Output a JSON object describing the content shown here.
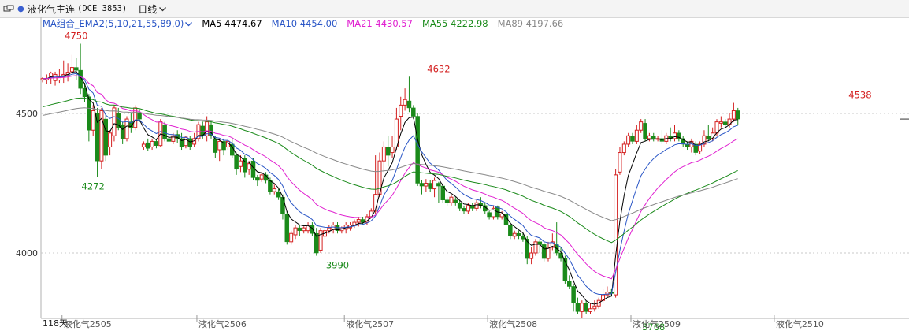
{
  "toolbar": {
    "window_icon": "window-restore-icon",
    "contract_name": "液化气主连",
    "contract_code": "(DCE 3853)",
    "period": "日线",
    "period_icon": "chevron-down-icon"
  },
  "legend": {
    "ma_group": "MA组合_EMA2(5,10,21,55,89,0)",
    "ma_group_icon": "chevron-down-icon",
    "items": [
      {
        "label": "MA5 4474.67",
        "color": "#000000"
      },
      {
        "label": "MA10 4454.00",
        "color": "#2a56c6"
      },
      {
        "label": "MA21 4430.57",
        "color": "#e020d0"
      },
      {
        "label": "MA55 4222.98",
        "color": "#1a8a1a"
      },
      {
        "label": "MA89 4197.66",
        "color": "#888888"
      }
    ]
  },
  "chart_data": {
    "type": "candlestick",
    "y_ticks": [
      4000,
      4500
    ],
    "x_labels": [
      {
        "label": "液化气2505",
        "index": 5
      },
      {
        "label": "液化气2506",
        "index": 37
      },
      {
        "label": "液化气2507",
        "index": 72
      },
      {
        "label": "液化气2508",
        "index": 106
      },
      {
        "label": "液化气2509",
        "index": 140
      },
      {
        "label": "液化气2510",
        "index": 174
      }
    ],
    "bottom_note": "118天",
    "annotations": [
      {
        "text": "4750",
        "index": 8,
        "value": 4750,
        "kind": "high"
      },
      {
        "text": "4272",
        "index": 12,
        "value": 4272,
        "kind": "low"
      },
      {
        "text": "3990",
        "index": 70,
        "value": 3990,
        "kind": "low"
      },
      {
        "text": "4632",
        "index": 94,
        "value": 4632,
        "kind": "high"
      },
      {
        "text": "3768",
        "index": 145,
        "value": 3768,
        "kind": "low"
      },
      {
        "text": "4538",
        "index": 194,
        "value": 4538,
        "kind": "high"
      }
    ],
    "up_color": "#d42020",
    "down_color": "#1a8a1a",
    "candles": [
      [
        4620,
        4625,
        4612,
        4630
      ],
      [
        4620,
        4625,
        4605,
        4640
      ],
      [
        4630,
        4645,
        4605,
        4650
      ],
      [
        4618,
        4640,
        4600,
        4650
      ],
      [
        4620,
        4630,
        4610,
        4660
      ],
      [
        4630,
        4640,
        4610,
        4690
      ],
      [
        4640,
        4648,
        4615,
        4680
      ],
      [
        4650,
        4665,
        4630,
        4710
      ],
      [
        4665,
        4655,
        4620,
        4700
      ],
      [
        4655,
        4590,
        4570,
        4750
      ],
      [
        4590,
        4560,
        4540,
        4610
      ],
      [
        4560,
        4440,
        4400,
        4570
      ],
      [
        4440,
        4510,
        4420,
        4530
      ],
      [
        4500,
        4330,
        4272,
        4520
      ],
      [
        4330,
        4510,
        4300,
        4520
      ],
      [
        4480,
        4350,
        4330,
        4500
      ],
      [
        4380,
        4430,
        4350,
        4440
      ],
      [
        4420,
        4520,
        4400,
        4530
      ],
      [
        4500,
        4450,
        4440,
        4520
      ],
      [
        4460,
        4410,
        4390,
        4470
      ],
      [
        4410,
        4480,
        4400,
        4490
      ],
      [
        4470,
        4450,
        4430,
        4500
      ],
      [
        4450,
        4520,
        4440,
        4530
      ],
      [
        4500,
        4480,
        4470,
        4515
      ],
      [
        4380,
        4390,
        4370,
        4400
      ],
      [
        4395,
        4375,
        4365,
        4410
      ],
      [
        4380,
        4400,
        4370,
        4410
      ],
      [
        4400,
        4385,
        4375,
        4410
      ],
      [
        4385,
        4470,
        4380,
        4480
      ],
      [
        4460,
        4410,
        4400,
        4470
      ],
      [
        4410,
        4400,
        4385,
        4420
      ],
      [
        4400,
        4420,
        4390,
        4430
      ],
      [
        4425,
        4410,
        4395,
        4440
      ],
      [
        4410,
        4380,
        4370,
        4430
      ],
      [
        4385,
        4415,
        4375,
        4420
      ],
      [
        4410,
        4380,
        4370,
        4420
      ],
      [
        4390,
        4410,
        4380,
        4430
      ],
      [
        4410,
        4460,
        4400,
        4470
      ],
      [
        4455,
        4420,
        4410,
        4470
      ],
      [
        4420,
        4470,
        4400,
        4490
      ],
      [
        4460,
        4420,
        4410,
        4470
      ],
      [
        4410,
        4360,
        4340,
        4420
      ],
      [
        4370,
        4400,
        4330,
        4410
      ],
      [
        4400,
        4370,
        4350,
        4410
      ],
      [
        4380,
        4400,
        4370,
        4410
      ],
      [
        4390,
        4350,
        4340,
        4410
      ],
      [
        4350,
        4300,
        4280,
        4360
      ],
      [
        4310,
        4330,
        4290,
        4350
      ],
      [
        4340,
        4290,
        4270,
        4350
      ],
      [
        4300,
        4320,
        4280,
        4330
      ],
      [
        4330,
        4270,
        4260,
        4340
      ],
      [
        4270,
        4260,
        4240,
        4280
      ],
      [
        4265,
        4280,
        4255,
        4290
      ],
      [
        4280,
        4260,
        4250,
        4290
      ],
      [
        4260,
        4220,
        4210,
        4270
      ],
      [
        4220,
        4230,
        4210,
        4245
      ],
      [
        4220,
        4200,
        4190,
        4230
      ],
      [
        4200,
        4140,
        4120,
        4210
      ],
      [
        4140,
        4040,
        4030,
        4150
      ],
      [
        4040,
        4070,
        4030,
        4080
      ],
      [
        4065,
        4090,
        4050,
        4100
      ],
      [
        4090,
        4080,
        4060,
        4100
      ],
      [
        4080,
        4090,
        4070,
        4095
      ],
      [
        4080,
        4100,
        4070,
        4110
      ],
      [
        4100,
        4070,
        4060,
        4110
      ],
      [
        4070,
        4000,
        3990,
        4090
      ],
      [
        4010,
        4080,
        4000,
        4090
      ],
      [
        4060,
        4080,
        4050,
        4090
      ],
      [
        4080,
        4090,
        4070,
        4100
      ],
      [
        4085,
        4100,
        4070,
        4110
      ],
      [
        4100,
        4080,
        4070,
        4110
      ],
      [
        4080,
        4090,
        4070,
        4095
      ],
      [
        4085,
        4100,
        4070,
        4110
      ],
      [
        4090,
        4100,
        4080,
        4110
      ],
      [
        4100,
        4110,
        4090,
        4120
      ],
      [
        4110,
        4120,
        4095,
        4130
      ],
      [
        4120,
        4110,
        4100,
        4130
      ],
      [
        4110,
        4130,
        4100,
        4140
      ],
      [
        4130,
        4150,
        4125,
        4160
      ],
      [
        4150,
        4210,
        4140,
        4350
      ],
      [
        4210,
        4330,
        4200,
        4360
      ],
      [
        4330,
        4380,
        4290,
        4400
      ],
      [
        4380,
        4350,
        4310,
        4420
      ],
      [
        4360,
        4380,
        4340,
        4420
      ],
      [
        4380,
        4480,
        4370,
        4520
      ],
      [
        4490,
        4530,
        4440,
        4560
      ],
      [
        4530,
        4550,
        4510,
        4590
      ],
      [
        4545,
        4520,
        4505,
        4632
      ],
      [
        4520,
        4490,
        4480,
        4530
      ],
      [
        4490,
        4250,
        4240,
        4500
      ],
      [
        4250,
        4240,
        4210,
        4260
      ],
      [
        4240,
        4250,
        4220,
        4265
      ],
      [
        4250,
        4230,
        4220,
        4260
      ],
      [
        4230,
        4260,
        4200,
        4270
      ],
      [
        4250,
        4240,
        4180,
        4255
      ],
      [
        4240,
        4190,
        4180,
        4250
      ],
      [
        4190,
        4180,
        4170,
        4200
      ],
      [
        4180,
        4200,
        4170,
        4210
      ],
      [
        4190,
        4180,
        4170,
        4200
      ],
      [
        4180,
        4160,
        4150,
        4190
      ],
      [
        4160,
        4150,
        4140,
        4170
      ],
      [
        4150,
        4170,
        4140,
        4180
      ],
      [
        4170,
        4160,
        4150,
        4180
      ],
      [
        4160,
        4180,
        4150,
        4190
      ],
      [
        4180,
        4170,
        4160,
        4200
      ],
      [
        4170,
        4150,
        4140,
        4180
      ],
      [
        4145,
        4130,
        4120,
        4150
      ],
      [
        4130,
        4160,
        4120,
        4170
      ],
      [
        4165,
        4130,
        4120,
        4170
      ],
      [
        4130,
        4140,
        4120,
        4150
      ],
      [
        4140,
        4100,
        4090,
        4150
      ],
      [
        4100,
        4060,
        4050,
        4110
      ],
      [
        4060,
        4070,
        4050,
        4080
      ],
      [
        4070,
        4060,
        4050,
        4080
      ],
      [
        4060,
        4050,
        4040,
        4070
      ],
      [
        4050,
        3980,
        3960,
        4060
      ],
      [
        3980,
        4000,
        3960,
        4020
      ],
      [
        4000,
        4040,
        3990,
        4050
      ],
      [
        4040,
        4030,
        4000,
        4050
      ],
      [
        4030,
        3980,
        3970,
        4040
      ],
      [
        3980,
        4020,
        3970,
        4040
      ],
      [
        4020,
        4040,
        4010,
        4070
      ],
      [
        4030,
        4000,
        3990,
        4110
      ],
      [
        4000,
        3980,
        3970,
        4020
      ],
      [
        3980,
        3900,
        3890,
        3990
      ],
      [
        3900,
        3880,
        3870,
        3920
      ],
      [
        3880,
        3820,
        3790,
        3890
      ],
      [
        3820,
        3790,
        3780,
        3840
      ],
      [
        3790,
        3820,
        3768,
        3830
      ],
      [
        3820,
        3790,
        3780,
        3830
      ],
      [
        3790,
        3800,
        3780,
        3820
      ],
      [
        3800,
        3810,
        3790,
        3830
      ],
      [
        3810,
        3830,
        3800,
        3840
      ],
      [
        3830,
        3850,
        3820,
        3870
      ],
      [
        3850,
        3860,
        3840,
        3880
      ],
      [
        3860,
        3855,
        3845,
        3870
      ],
      [
        3850,
        4280,
        3840,
        4300
      ],
      [
        4290,
        4360,
        4280,
        4380
      ],
      [
        4360,
        4390,
        4350,
        4400
      ],
      [
        4390,
        4420,
        4380,
        4430
      ],
      [
        4420,
        4400,
        4390,
        4430
      ],
      [
        4400,
        4440,
        4390,
        4460
      ],
      [
        4440,
        4470,
        4430,
        4480
      ],
      [
        4465,
        4410,
        4400,
        4480
      ],
      [
        4410,
        4420,
        4400,
        4430
      ],
      [
        4420,
        4410,
        4400,
        4430
      ],
      [
        4410,
        4410,
        4400,
        4420
      ],
      [
        4410,
        4400,
        4390,
        4440
      ],
      [
        4400,
        4420,
        4390,
        4430
      ],
      [
        4420,
        4410,
        4400,
        4450
      ],
      [
        4410,
        4430,
        4400,
        4460
      ],
      [
        4430,
        4410,
        4400,
        4440
      ],
      [
        4410,
        4390,
        4380,
        4420
      ],
      [
        4390,
        4380,
        4370,
        4400
      ],
      [
        4380,
        4400,
        4360,
        4410
      ],
      [
        4390,
        4360,
        4350,
        4400
      ],
      [
        4365,
        4390,
        4355,
        4400
      ],
      [
        4390,
        4420,
        4380,
        4440
      ],
      [
        4420,
        4410,
        4400,
        4460
      ],
      [
        4410,
        4430,
        4400,
        4450
      ],
      [
        4430,
        4470,
        4420,
        4480
      ],
      [
        4465,
        4470,
        4450,
        4490
      ],
      [
        4470,
        4460,
        4450,
        4480
      ],
      [
        4460,
        4480,
        4450,
        4500
      ],
      [
        4480,
        4510,
        4470,
        4538
      ],
      [
        4510,
        4480,
        4460,
        4520
      ]
    ]
  }
}
